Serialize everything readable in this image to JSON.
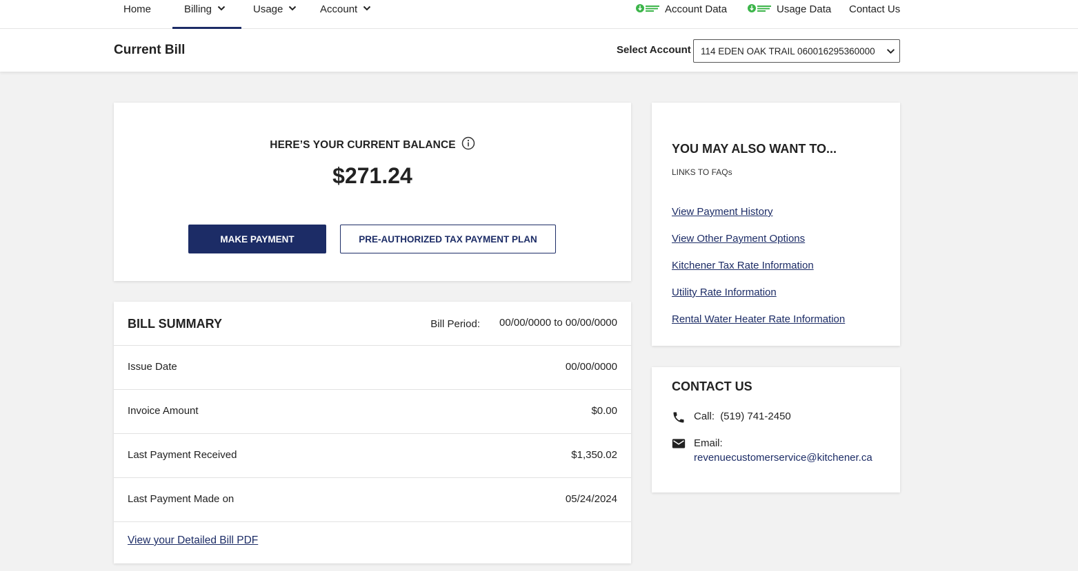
{
  "nav": {
    "home": "Home",
    "billing": "Billing",
    "usage": "Usage",
    "account": "Account",
    "account_data": "Account Data",
    "usage_data": "Usage Data",
    "contact_us": "Contact Us"
  },
  "header": {
    "title": "Current Bill",
    "select_label": "Select Account",
    "selected_account": "114 EDEN OAK TRAIL 060016295360000"
  },
  "balance": {
    "heading": "HERE’S YOUR CURRENT BALANCE",
    "amount": "$271.24",
    "make_payment": "MAKE PAYMENT",
    "pap_plan": "PRE-AUTHORIZED TAX PAYMENT PLAN"
  },
  "summary": {
    "title": "BILL SUMMARY",
    "period_label": "Bill Period:",
    "period_value": "00/00/0000 to 00/00/0000",
    "rows": [
      {
        "label": "Issue Date",
        "value": "00/00/0000"
      },
      {
        "label": "Invoice Amount",
        "value": "$0.00"
      },
      {
        "label": "Last Payment Received",
        "value": "$1,350.02"
      },
      {
        "label": "Last Payment Made on",
        "value": "05/24/2024"
      }
    ],
    "pdf_link": "View your Detailed Bill PDF"
  },
  "links": {
    "title": "YOU MAY ALSO WANT TO...",
    "subtitle": "LINKS TO FAQs",
    "items": [
      "View Payment History",
      "View Other Payment Options",
      "Kitchener Tax Rate Information",
      "Utility Rate Information",
      "Rental Water Heater Rate Information"
    ]
  },
  "contact": {
    "title": "CONTACT US",
    "call_label": "Call:",
    "phone": "(519) 741-2450",
    "email_label": "Email:",
    "email": "revenuecustomerservice@kitchener.ca"
  },
  "colors": {
    "accent": "#1c2c66",
    "green_button_icon": "#3cb54a",
    "background": "#f2f2f2"
  },
  "icons": [
    "chevron-down-icon",
    "green-button-icon",
    "info-icon",
    "phone-icon",
    "email-icon"
  ]
}
